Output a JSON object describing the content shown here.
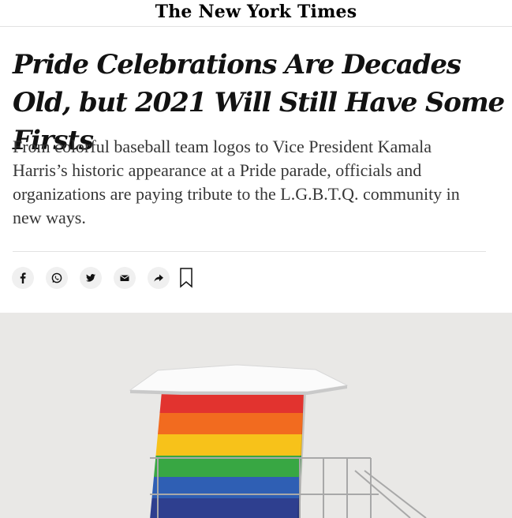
{
  "masthead": {
    "logo_text": "The New York Times"
  },
  "article": {
    "headline": "Pride Celebrations Are Decades Old, but 2021 Will Still Have Some Firsts",
    "summary": "From colorful baseball team logos to Vice President Kamala Harris’s historic appearance at a Pride parade, officials and organizations are paying tribute to the L.G.B.T.Q. community in new ways."
  },
  "share_tools": {
    "icons": [
      "facebook-icon",
      "whatsapp-icon",
      "twitter-icon",
      "email-icon",
      "share-arrow-icon",
      "bookmark-icon"
    ]
  },
  "photo": {
    "subject": "lifeguard-tower-rainbow",
    "colors": [
      "#e2332f",
      "#f26b1f",
      "#f7c21a",
      "#38a743",
      "#2f5fb4",
      "#2e3f8f"
    ],
    "roof_color": "#ffffff",
    "sky_color": "#e9e8e6"
  }
}
